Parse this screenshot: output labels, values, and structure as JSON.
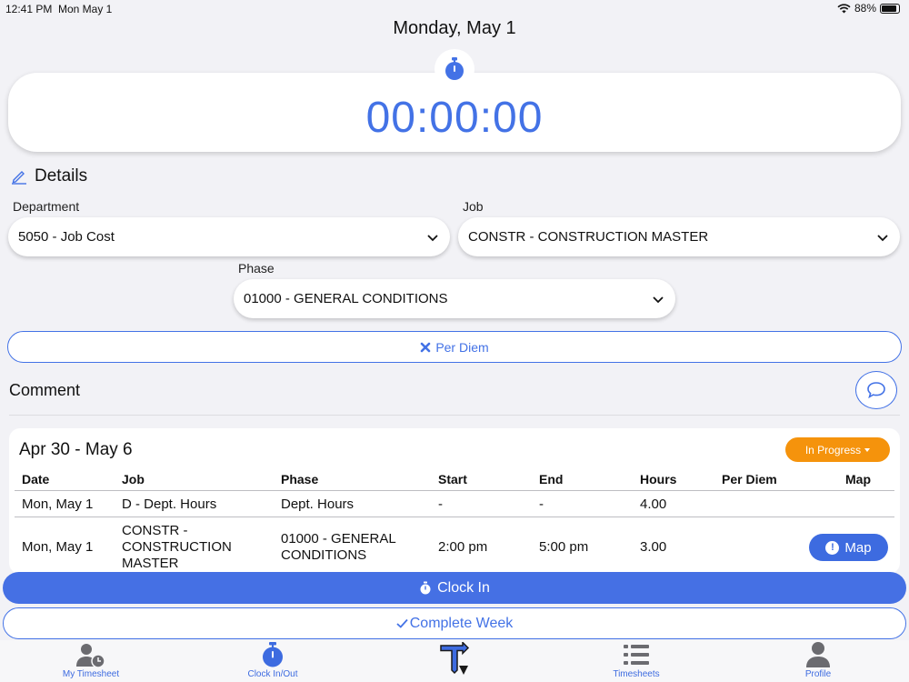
{
  "status_bar": {
    "time": "12:41 PM",
    "date": "Mon May 1",
    "battery": "88%"
  },
  "header": {
    "title": "Monday, May 1"
  },
  "timer": {
    "value": "00:00:00",
    "icon": "stopwatch-icon"
  },
  "details": {
    "heading": "Details",
    "department": {
      "label": "Department",
      "value": "5050 - Job Cost"
    },
    "job": {
      "label": "Job",
      "value": "CONSTR - CONSTRUCTION MASTER"
    },
    "phase": {
      "label": "Phase",
      "value": "01000 - GENERAL CONDITIONS"
    }
  },
  "per_diem_button": {
    "label": "Per Diem",
    "icon": "x-icon"
  },
  "comment": {
    "label": "Comment",
    "icon": "chat-bubble-icon"
  },
  "week": {
    "range": "Apr 30 - May 6",
    "status": "In Progress",
    "columns": [
      "Date",
      "Job",
      "Phase",
      "Start",
      "End",
      "Hours",
      "Per Diem",
      "Map"
    ],
    "rows": [
      {
        "date": "Mon, May 1",
        "job": "D - Dept. Hours",
        "phase": "Dept. Hours",
        "start": "-",
        "end": "-",
        "hours": "4.00",
        "per_diem": "",
        "map": ""
      },
      {
        "date": "Mon, May 1",
        "job": "CONSTR - CONSTRUCTION MASTER",
        "phase": "01000 - GENERAL CONDITIONS",
        "start": "2:00 pm",
        "end": "5:00 pm",
        "hours": "3.00",
        "per_diem": "",
        "map": "Map"
      }
    ]
  },
  "clock_in_button": {
    "label": "Clock In"
  },
  "complete_week_button": {
    "label": "Complete Week"
  },
  "tabbar": {
    "items": [
      {
        "label": "My Timesheet",
        "icon": "person-clock-icon"
      },
      {
        "label": "Clock In/Out",
        "icon": "stopwatch-icon"
      },
      {
        "label": "",
        "icon": "app-logo-icon"
      },
      {
        "label": "Timesheets",
        "icon": "list-icon"
      },
      {
        "label": "Profile",
        "icon": "person-icon"
      }
    ]
  },
  "colors": {
    "accent": "#4372e6",
    "status_in_progress": "#f5930c",
    "background": "#f2f2f6"
  }
}
